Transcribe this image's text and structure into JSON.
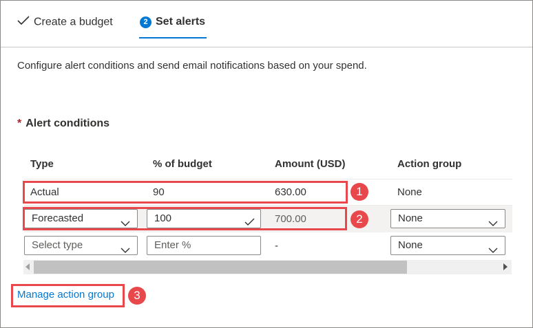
{
  "wizard": {
    "step1": {
      "label": "Create a budget",
      "icon": "checkmark-icon"
    },
    "step2": {
      "number": "2",
      "label": "Set alerts"
    }
  },
  "description": "Configure alert conditions and send email notifications based on your spend.",
  "section": {
    "required_marker": "*",
    "title": "Alert conditions"
  },
  "table": {
    "headers": [
      "Type",
      "% of budget",
      "Amount (USD)",
      "Action group"
    ],
    "rows": [
      {
        "type": "Actual",
        "percent": "90",
        "amount": "630.00",
        "action_group": "None"
      },
      {
        "type": "Forecasted",
        "percent": "100",
        "amount": "700.00",
        "action_group": "None"
      },
      {
        "type_placeholder": "Select type",
        "percent_placeholder": "Enter %",
        "amount": "-",
        "action_group": "None"
      }
    ]
  },
  "link": "Manage action group",
  "callouts": [
    "1",
    "2",
    "3"
  ],
  "colors": {
    "accent": "#0078d4",
    "callout": "#e8474c",
    "required": "#a4262c"
  }
}
